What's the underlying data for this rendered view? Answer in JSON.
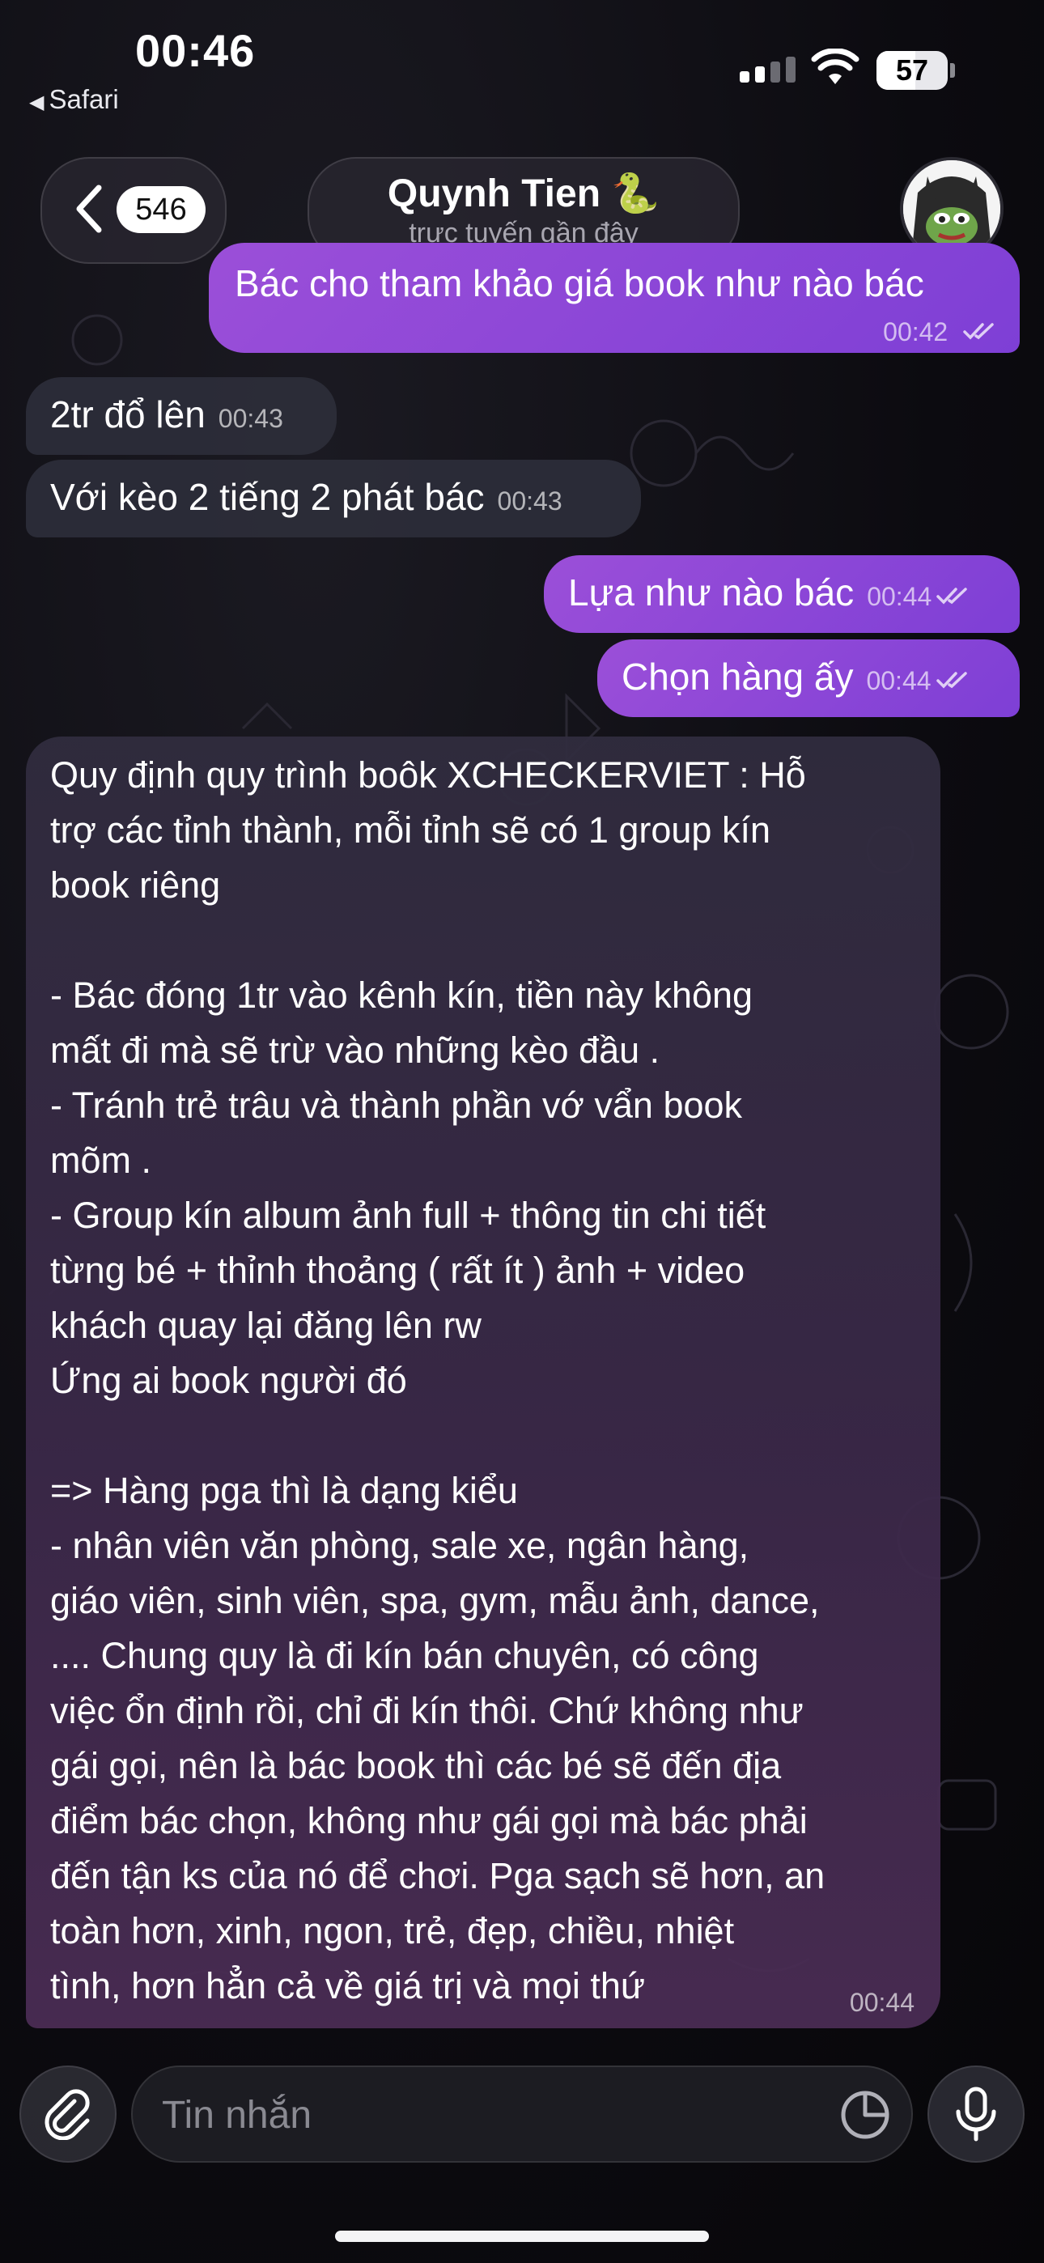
{
  "status_bar": {
    "time": "00:46",
    "back_app": "Safari",
    "battery": "57"
  },
  "header": {
    "unread_count": "546",
    "contact_name": "Quynh Tien 🐍",
    "contact_status": "trực tuyến gần đây"
  },
  "messages": [
    {
      "direction": "out",
      "text": "Bác cho tham khảo giá book như nào bác",
      "time": "00:42",
      "read": true
    },
    {
      "direction": "in",
      "text": "2tr đổ lên",
      "time": "00:43"
    },
    {
      "direction": "in",
      "text": "Với kèo 2 tiếng 2 phát bác",
      "time": "00:43"
    },
    {
      "direction": "out",
      "text": "Lựa như nào bác",
      "time": "00:44",
      "read": true
    },
    {
      "direction": "out",
      "text": "Chọn hàng ấy",
      "time": "00:44",
      "read": true
    },
    {
      "direction": "in",
      "text": "Quy định quy trình boôk XCHECKERVIET : Hỗ\ntrợ các tỉnh thành, mỗi tỉnh sẽ có 1 group kín\nbook riêng\n\n- Bác đóng 1tr vào kênh kín, tiền này không\nmất đi mà sẽ trừ vào những kèo đầu .\n- Tránh trẻ trâu và thành phần vớ vẩn book\nmõm .\n- Group kín album ảnh full + thông tin chi tiết\ntừng bé + thỉnh thoảng ( rất ít ) ảnh + video\nkhách quay lại đăng lên rw\nỨng ai book người đó\n\n=> Hàng pga thì là dạng kiểu\n- nhân viên văn phòng, sale xe, ngân hàng,\ngiáo viên, sinh viên, spa, gym, mẫu ảnh, dance,\n.... Chung quy là đi kín bán chuyên, có công\nviệc ổn định rồi, chỉ đi kín thôi. Chứ không như\ngái gọi, nên là bác book thì các bé sẽ đến địa\nđiểm bác chọn, không như gái gọi mà bác phải\nđến tận ks của nó để chơi. Pga sạch sẽ hơn, an\ntoàn hơn, xinh, ngon, trẻ, đẹp, chiều, nhiệt\ntình, hơn hẳn cả về giá trị và mọi thứ",
      "time": "00:44"
    }
  ],
  "composer": {
    "placeholder": "Tin nhắn"
  },
  "icons": [
    "chevron-left-icon",
    "paperclip-icon",
    "sticker-icon",
    "microphone-icon",
    "wifi-icon",
    "double-check-icon"
  ],
  "colors": {
    "outgoing_bubble": "#8b46d8",
    "incoming_bubble": "#2c2e3a",
    "background": "#0c0b10"
  }
}
